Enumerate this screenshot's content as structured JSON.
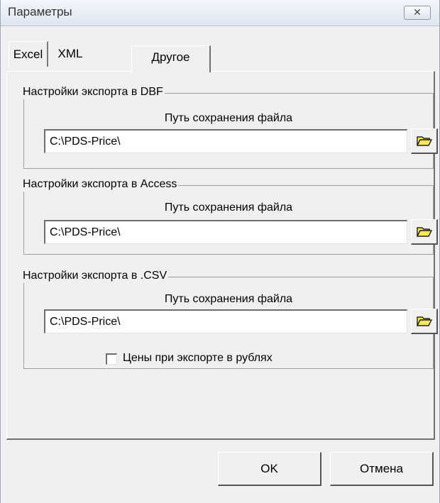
{
  "window": {
    "title": "Параметры",
    "close_symbol": "✕"
  },
  "tabs": [
    {
      "label": "Excel",
      "active": false
    },
    {
      "label": "XML",
      "active": false
    },
    {
      "label": "Другое",
      "active": true
    }
  ],
  "groups": {
    "dbf": {
      "title": "Настройки экспорта в DBF",
      "path_label": "Путь сохранения файла",
      "path_value": "C:\\PDS-Price\\",
      "browse_icon": "folder-open-icon"
    },
    "access": {
      "title": "Настройки экспорта в Access",
      "path_label": "Путь сохранения файла",
      "path_value": "C:\\PDS-Price\\",
      "browse_icon": "folder-open-icon"
    },
    "csv": {
      "title": "Настройки экспорта в .CSV",
      "path_label": "Путь сохранения файла",
      "path_value": "C:\\PDS-Price\\",
      "browse_icon": "folder-open-icon",
      "rubles_checkbox": {
        "label": "Цены при экспорте в рублях",
        "checked": false
      }
    }
  },
  "buttons": {
    "ok": "OK",
    "cancel": "Отмена"
  },
  "colors": {
    "face": "#f0f0f0",
    "folder_icon": "#f7e85a"
  }
}
